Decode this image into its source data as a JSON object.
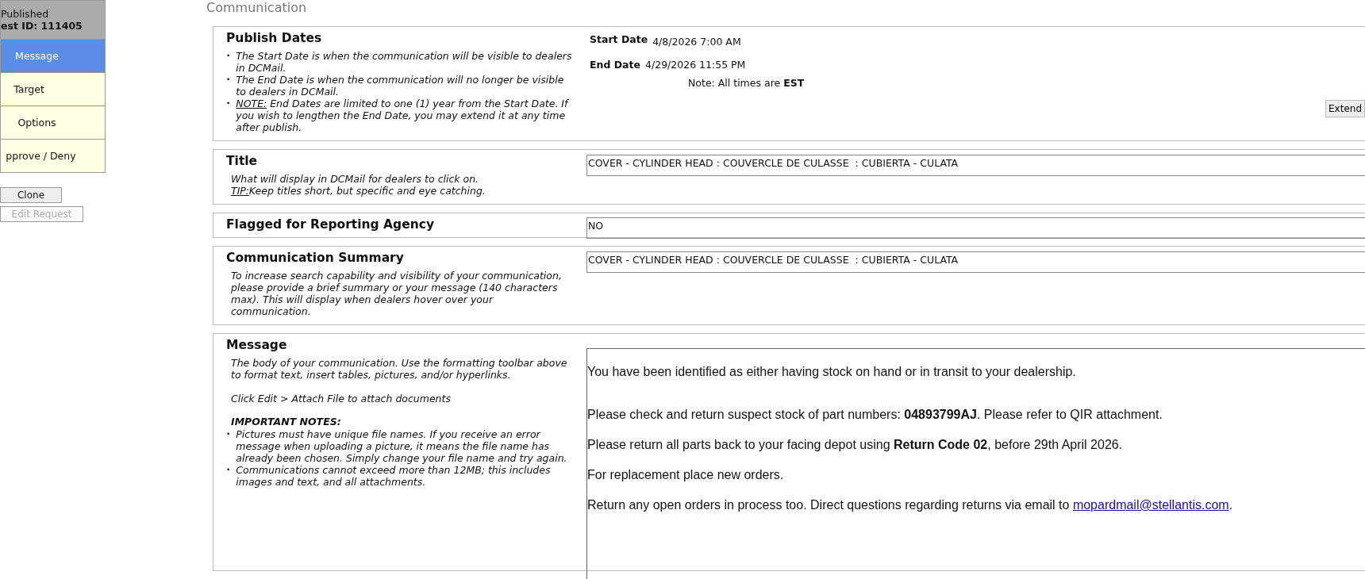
{
  "sidebar": {
    "status": "Published",
    "request_id": "est ID: 111405",
    "items": [
      {
        "label": "Message",
        "selected": true
      },
      {
        "label": "Target",
        "selected": false
      },
      {
        "label": "Options",
        "selected": false
      },
      {
        "label": "pprove / Deny",
        "selected": false
      }
    ],
    "buttons": [
      {
        "label": "Clone",
        "disabled": false
      },
      {
        "label": "Edit Request",
        "disabled": true
      }
    ]
  },
  "page_title": "Communication",
  "publish_dates": {
    "heading": "Publish Dates",
    "notes": [
      {
        "marker": "•",
        "text": "The Start Date is when the communication will be visible to dealers in DCMail."
      },
      {
        "marker": "•",
        "text": "The End Date is when the communication will no longer be visible to dealers in DCMail."
      },
      {
        "marker": "•",
        "lead": "NOTE:",
        "text": " End Dates are limited to one (1) year from the Start Date. If you wish to lengthen the End Date, you may extend it at any time after publish."
      }
    ],
    "start_label": "Start Date",
    "start_value": "4/8/2026 7:00 AM",
    "end_label": "End Date",
    "end_value": "4/29/2026 11:55 PM",
    "note": "Note: All times are **EST**",
    "extend_button": "Extend"
  },
  "title_section": {
    "heading": "Title",
    "help": "What will display in DCMail for dealers to click on.",
    "tip_lead": "TIP:",
    "tip": "Keep titles short, but specific and eye catching.",
    "value": "COVER - CYLINDER HEAD : COUVERCLE DE CULASSE  : CUBIERTA - CULATA"
  },
  "flagged": {
    "heading": "Flagged for Reporting Agency",
    "value": "NO"
  },
  "summary": {
    "heading": "Communication Summary",
    "help": "To increase search capability and visibility of your communication, please provide a brief summary or your message (140 characters max). This will display when dealers hover over your communication.",
    "value": "COVER - CYLINDER HEAD : COUVERCLE DE CULASSE  : CUBIERTA - CULATA"
  },
  "message": {
    "heading": "Message",
    "help": "The body of your communication. Use the formatting toolbar above to format text, insert tables, pictures, and/or hyperlinks.",
    "attach_help": "Click Edit > Attach File to attach documents",
    "notes_heading": "IMPORTANT NOTES:",
    "notes": [
      {
        "marker": "•",
        "text": "Pictures must have unique file names. If you receive an error message when uploading a picture, it means the file name has already been chosen. Simply change your file name and try again."
      },
      {
        "marker": "•",
        "text": "Communications cannot exceed more than 12MB; this includes images and text, and all attachments."
      }
    ],
    "body": [
      {
        "text": "You have been identified as either having stock on hand or in transit to your dealership."
      },
      {
        "text": "Please check and return suspect stock of part numbers: **04893799AJ**. Please refer to QIR attachment."
      },
      {
        "text": "Please return all parts back to your facing depot using **Return Code 02**, before 29th April 2026."
      },
      {
        "text": "For replacement place new orders."
      },
      {
        "text": "Return any open orders in process too. Direct questions regarding returns via email to ",
        "link": "mopardmail@stellantis.com",
        "after": "."
      }
    ]
  }
}
